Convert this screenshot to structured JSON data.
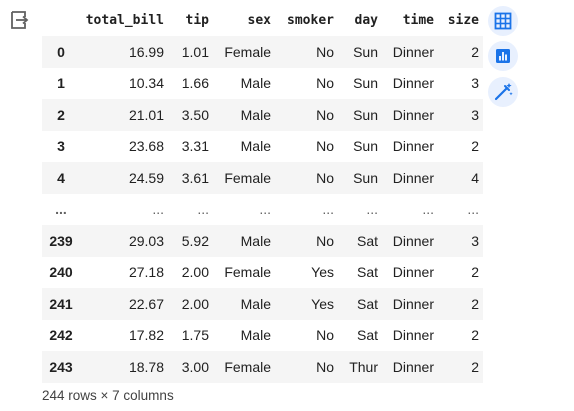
{
  "output_icon": "output-redirect-icon",
  "table": {
    "columns": [
      "total_bill",
      "tip",
      "sex",
      "smoker",
      "day",
      "time",
      "size"
    ],
    "rows": [
      {
        "index": "0",
        "cells": [
          "16.99",
          "1.01",
          "Female",
          "No",
          "Sun",
          "Dinner",
          "2"
        ]
      },
      {
        "index": "1",
        "cells": [
          "10.34",
          "1.66",
          "Male",
          "No",
          "Sun",
          "Dinner",
          "3"
        ]
      },
      {
        "index": "2",
        "cells": [
          "21.01",
          "3.50",
          "Male",
          "No",
          "Sun",
          "Dinner",
          "3"
        ]
      },
      {
        "index": "3",
        "cells": [
          "23.68",
          "3.31",
          "Male",
          "No",
          "Sun",
          "Dinner",
          "2"
        ]
      },
      {
        "index": "4",
        "cells": [
          "24.59",
          "3.61",
          "Female",
          "No",
          "Sun",
          "Dinner",
          "4"
        ]
      },
      {
        "index": "...",
        "cells": [
          "...",
          "...",
          "...",
          "...",
          "...",
          "...",
          "..."
        ]
      },
      {
        "index": "239",
        "cells": [
          "29.03",
          "5.92",
          "Male",
          "No",
          "Sat",
          "Dinner",
          "3"
        ]
      },
      {
        "index": "240",
        "cells": [
          "27.18",
          "2.00",
          "Female",
          "Yes",
          "Sat",
          "Dinner",
          "2"
        ]
      },
      {
        "index": "241",
        "cells": [
          "22.67",
          "2.00",
          "Male",
          "Yes",
          "Sat",
          "Dinner",
          "2"
        ]
      },
      {
        "index": "242",
        "cells": [
          "17.82",
          "1.75",
          "Male",
          "No",
          "Sat",
          "Dinner",
          "2"
        ]
      },
      {
        "index": "243",
        "cells": [
          "18.78",
          "3.00",
          "Female",
          "No",
          "Thur",
          "Dinner",
          "2"
        ]
      }
    ]
  },
  "footer": {
    "shape_text": "244 rows × 7 columns"
  },
  "toolbar": [
    {
      "name": "table-view-button",
      "icon": "table-icon"
    },
    {
      "name": "chart-suggest-button",
      "icon": "bar-chart-icon"
    },
    {
      "name": "magic-generate-button",
      "icon": "magic-wand-icon"
    }
  ],
  "colors": {
    "accent": "#1a73e8",
    "button_bg": "#e8f0fe",
    "row_stripe": "#f5f5f5"
  }
}
